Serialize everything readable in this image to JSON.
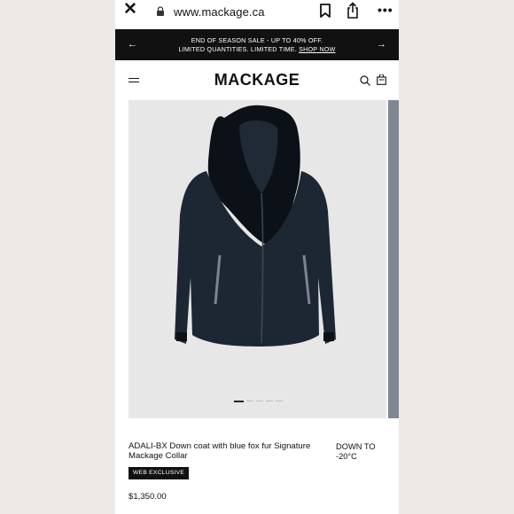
{
  "browser": {
    "url": "www.mackage.ca",
    "icons": [
      "close-icon",
      "lock-icon",
      "bookmark-icon",
      "share-icon",
      "more-icon"
    ]
  },
  "promo": {
    "line1": "END OF SEASON SALE - UP TO 40% OFF.",
    "line2": "LIMITED QUANTITIES. LIMITED TIME.",
    "link": "SHOP NOW",
    "prev_icon": "←",
    "next_icon": "→"
  },
  "header": {
    "logo": "MACKAGE",
    "menu_icon": "hamburger-icon",
    "search_icon": "search-icon",
    "cart_icon": "cart-icon"
  },
  "product": {
    "name": "ADALI-BX Down coat with blue fox fur Signature Mackage Collar",
    "temperature": "DOWN TO -20°C",
    "badge": "WEB EXCLUSIVE",
    "price": "$1,350.00",
    "image_count": 5,
    "active_image": 1
  },
  "colors": {
    "banner_bg": "#111111",
    "image_bg": "#e7e7e7",
    "coat": "#1d2733"
  }
}
